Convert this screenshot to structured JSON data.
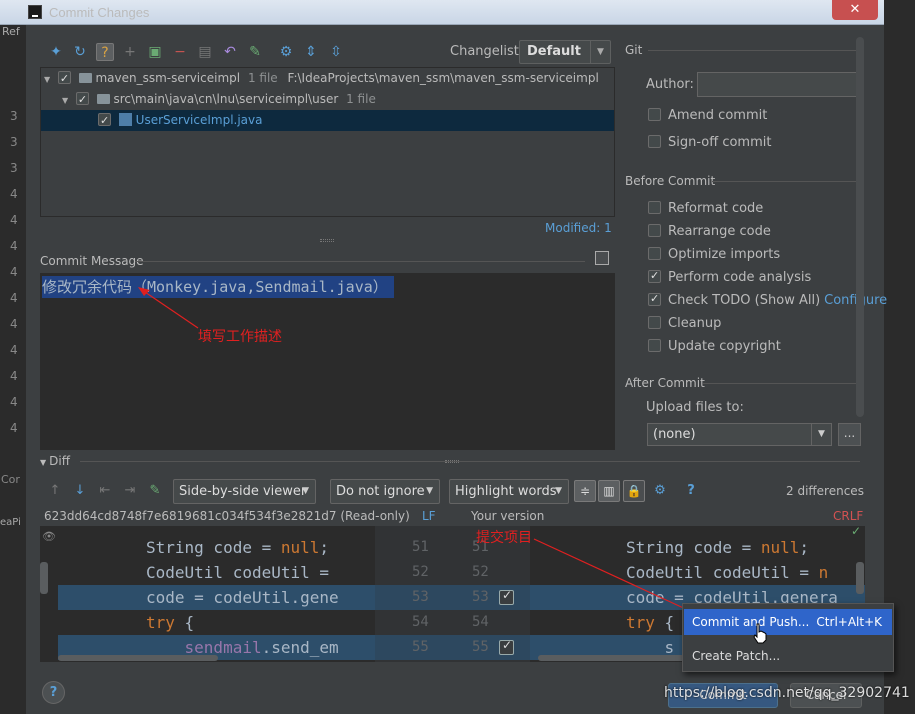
{
  "window": {
    "title": "Commit Changes",
    "close_symbol": "✕"
  },
  "background_ide": {
    "line_numbers": [
      "3",
      "3",
      "3",
      "4",
      "4",
      "4",
      "4",
      "4",
      "4",
      "4",
      "4",
      "4",
      "4",
      "4"
    ],
    "tab_label": "Ref",
    "side_label": "Cor",
    "side_label2": "eaPi"
  },
  "toolbar": {
    "changelist_label": "Changelist:",
    "changelist_value": "Default"
  },
  "tree": {
    "rows": [
      {
        "name": "maven_ssm-serviceimpl",
        "count": "1 file",
        "path": "F:\\IdeaProjects\\maven_ssm\\maven_ssm-serviceimpl"
      },
      {
        "name": "src\\main\\java\\cn\\lnu\\serviceimpl\\user",
        "count": "1 file"
      },
      {
        "name": "UserServiceImpl.java"
      }
    ],
    "modified": "Modified: 1"
  },
  "commit_message": {
    "label": "Commit Message",
    "text": "修改冗余代码（Monkey.java,Sendmail.java）",
    "annotation": "填写工作描述"
  },
  "git": {
    "section_label": "Git",
    "author_label": "Author:",
    "author_value": "",
    "amend_commit": "Amend commit",
    "sign_off_commit": "Sign-off commit"
  },
  "before_commit": {
    "label": "Before Commit",
    "options": [
      {
        "label": "Reformat code",
        "checked": false
      },
      {
        "label": "Rearrange code",
        "checked": false
      },
      {
        "label": "Optimize imports",
        "checked": false
      },
      {
        "label": "Perform code analysis",
        "checked": true
      },
      {
        "label": "Check TODO (Show All)",
        "checked": true,
        "link": "Configure"
      },
      {
        "label": "Cleanup",
        "checked": false
      },
      {
        "label": "Update copyright",
        "checked": false
      }
    ]
  },
  "after_commit": {
    "label": "After Commit",
    "upload_label": "Upload files to:",
    "upload_value": "(none)",
    "more_label": "..."
  },
  "diff": {
    "header": "Diff",
    "viewer_select": "Side-by-side viewer",
    "ignore_select": "Do not ignore",
    "highlight_select": "Highlight words",
    "help_symbol": "?",
    "count": "2 differences",
    "hash": "623dd64cd8748f7e6819681c034f534f3e2821d7 (Read-only)",
    "lf": "LF",
    "your_version": "Your version",
    "crlf": "CRLF",
    "annotation": "提交项目",
    "left_lines": [
      {
        "p1": "String code = ",
        "kw": "null",
        "p2": ";"
      },
      {
        "p1": "CodeUtil codeUtil = ",
        "kw": "",
        "p2": ""
      },
      {
        "p1": "code = codeUtil.gene",
        "kw": "",
        "p2": ""
      },
      {
        "p1": "",
        "kw": "try",
        "p2": " {"
      },
      {
        "p1": "    ",
        "fld": "sendmail",
        "p2": ".send_em"
      }
    ],
    "right_lines": [
      {
        "p1": "String code = ",
        "kw": "null",
        "p2": ";"
      },
      {
        "p1": "CodeUtil codeUtil = ",
        "kw": "n",
        "p2": ""
      },
      {
        "p1": "code = codeUtil.genera",
        "kw": "",
        "p2": ""
      },
      {
        "p1": "",
        "kw": "try",
        "p2": " {"
      },
      {
        "p1": "    s",
        "kw": "",
        "p2": ""
      }
    ],
    "left_numbers": [
      "51",
      "52",
      "53",
      "54",
      "55"
    ],
    "right_numbers": [
      "51",
      "52",
      "53",
      "54",
      "55"
    ]
  },
  "popup": {
    "items": [
      {
        "label": "Commit and Push...",
        "shortcut": "Ctrl+Alt+K"
      },
      {
        "label": "Create Patch...",
        "shortcut": ""
      }
    ]
  },
  "buttons": {
    "help": "?",
    "commit": "Commit",
    "cancel": "Cancel"
  },
  "watermark": "https://blog.csdn.net/qq_32902741"
}
